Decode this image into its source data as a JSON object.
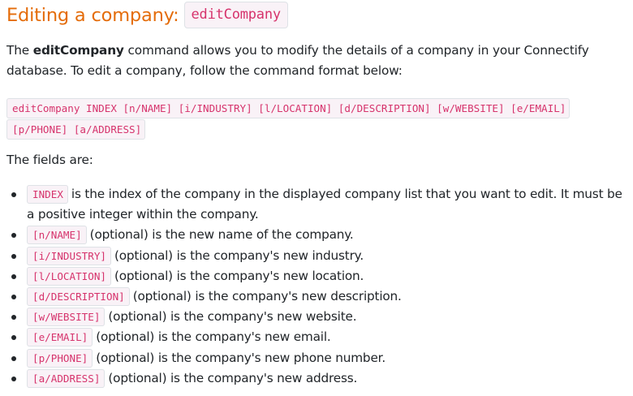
{
  "heading": {
    "prefix": "Editing a company:",
    "code": "editCompany"
  },
  "intro": {
    "before": "The ",
    "command": "editCompany",
    "after": " command allows you to modify the details of a company in your Connectify database. To edit a company, follow the command format below:"
  },
  "command_format": "editCompany INDEX [n/NAME] [i/INDUSTRY] [l/LOCATION] [d/DESCRIPTION] [w/WEBSITE] [e/EMAIL] [p/PHONE] [a/ADDRESS]",
  "fields_label": "The fields are:",
  "fields": [
    {
      "code": "INDEX",
      "text": "is the index of the company in the displayed company list that you want to edit. It must be a positive integer within the company."
    },
    {
      "code": "[n/NAME]",
      "text": "(optional) is the new name of the company."
    },
    {
      "code": "[i/INDUSTRY]",
      "text": "(optional) is the company's new industry."
    },
    {
      "code": "[l/LOCATION]",
      "text": "(optional) is the company's new location."
    },
    {
      "code": "[d/DESCRIPTION]",
      "text": "(optional) is the company's new description."
    },
    {
      "code": "[w/WEBSITE]",
      "text": "(optional) is the company's new website."
    },
    {
      "code": "[e/EMAIL]",
      "text": "(optional) is the company's new email."
    },
    {
      "code": "[p/PHONE]",
      "text": "(optional) is the company's new phone number."
    },
    {
      "code": "[a/ADDRESS]",
      "text": "(optional) is the company's new address."
    }
  ],
  "colors": {
    "heading": "#e46c0a",
    "code_text": "#d6336c",
    "code_bg": "#f9f2f7",
    "code_border": "#dee2e6",
    "body_text": "#212529"
  }
}
